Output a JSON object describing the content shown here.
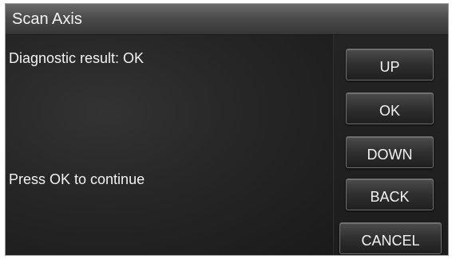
{
  "screen": {
    "title": "Scan Axis"
  },
  "messages": {
    "result": "Diagnostic result: OK",
    "continue": "Press OK to continue"
  },
  "buttons": {
    "up": "UP",
    "ok": "OK",
    "down": "DOWN",
    "back": "BACK",
    "cancel": "CANCEL"
  },
  "colors": {
    "background": "#151515",
    "text": "#f2f2f2",
    "title_bar": "#4a4a4a"
  }
}
